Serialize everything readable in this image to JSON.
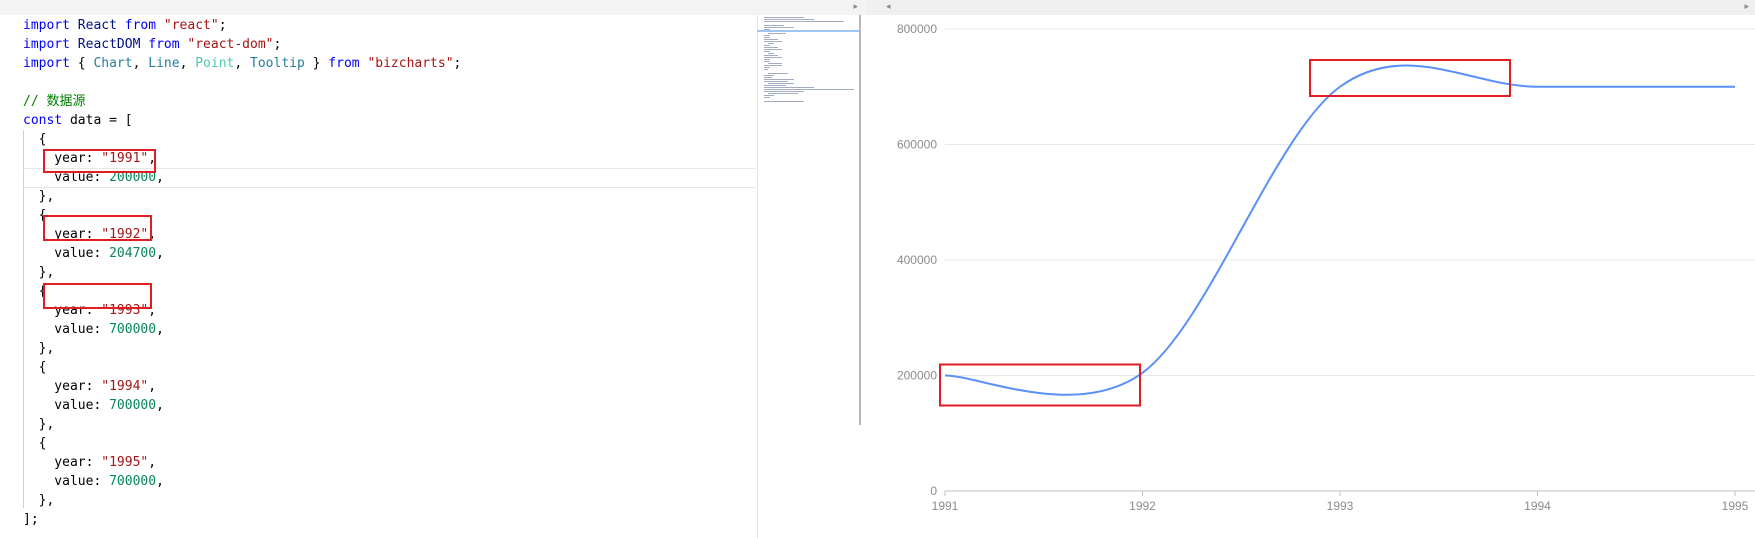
{
  "editor": {
    "lines": [
      [
        [
          "import",
          "kw"
        ],
        [
          " ",
          ""
        ],
        [
          "React",
          "var"
        ],
        [
          " ",
          ""
        ],
        [
          "from",
          "kw"
        ],
        [
          " ",
          ""
        ],
        [
          "\"react\"",
          "str"
        ],
        [
          ";",
          ""
        ]
      ],
      [
        [
          "import",
          "kw"
        ],
        [
          " ",
          ""
        ],
        [
          "ReactDOM",
          "var"
        ],
        [
          " ",
          ""
        ],
        [
          "from",
          "kw"
        ],
        [
          " ",
          ""
        ],
        [
          "\"react-dom\"",
          "str"
        ],
        [
          ";",
          ""
        ]
      ],
      [
        [
          "import",
          "kw"
        ],
        [
          " { ",
          ""
        ],
        [
          "Chart",
          "typ"
        ],
        [
          ", ",
          ""
        ],
        [
          "Line",
          "typ"
        ],
        [
          ", ",
          ""
        ],
        [
          "Point",
          "light"
        ],
        [
          ", ",
          ""
        ],
        [
          "Tooltip",
          "typ"
        ],
        [
          " } ",
          ""
        ],
        [
          "from",
          "kw"
        ],
        [
          " ",
          ""
        ],
        [
          "\"bizcharts\"",
          "str"
        ],
        [
          ";",
          ""
        ]
      ],
      [],
      [
        [
          "// 数据源",
          "cmt"
        ]
      ],
      [
        [
          "const",
          "kw"
        ],
        [
          " data = [",
          ""
        ]
      ],
      [
        [
          "  {",
          ""
        ]
      ],
      [
        [
          "    year: ",
          ""
        ],
        [
          "\"1991\"",
          "str"
        ],
        [
          ",",
          ""
        ]
      ],
      [
        [
          "    value: ",
          ""
        ],
        [
          "200000",
          "num"
        ],
        [
          ",",
          ""
        ]
      ],
      [
        [
          "  },",
          ""
        ]
      ],
      [
        [
          "  {",
          ""
        ]
      ],
      [
        [
          "    year: ",
          ""
        ],
        [
          "\"1992\"",
          "str"
        ],
        [
          ",",
          ""
        ]
      ],
      [
        [
          "    value: ",
          ""
        ],
        [
          "204700",
          "num"
        ],
        [
          ",",
          ""
        ]
      ],
      [
        [
          "  },",
          ""
        ]
      ],
      [
        [
          "  {",
          ""
        ]
      ],
      [
        [
          "    year: ",
          ""
        ],
        [
          "\"1993\"",
          "str"
        ],
        [
          ",",
          ""
        ]
      ],
      [
        [
          "    value: ",
          ""
        ],
        [
          "700000",
          "num"
        ],
        [
          ",",
          ""
        ]
      ],
      [
        [
          "  },",
          ""
        ]
      ],
      [
        [
          "  {",
          ""
        ]
      ],
      [
        [
          "    year: ",
          ""
        ],
        [
          "\"1994\"",
          "str"
        ],
        [
          ",",
          ""
        ]
      ],
      [
        [
          "    value: ",
          ""
        ],
        [
          "700000",
          "num"
        ],
        [
          ",",
          ""
        ]
      ],
      [
        [
          "  },",
          ""
        ]
      ],
      [
        [
          "  {",
          ""
        ]
      ],
      [
        [
          "    year: ",
          ""
        ],
        [
          "\"1995\"",
          "str"
        ],
        [
          ",",
          ""
        ]
      ],
      [
        [
          "    value: ",
          ""
        ],
        [
          "700000",
          "num"
        ],
        [
          ",",
          ""
        ]
      ],
      [
        [
          "  },",
          ""
        ]
      ],
      [
        [
          "];",
          ""
        ]
      ]
    ]
  },
  "chart_data": {
    "type": "line",
    "smooth": true,
    "x": [
      "1991",
      "1992",
      "1993",
      "1994",
      "1995"
    ],
    "y": [
      200000,
      204700,
      700000,
      700000,
      700000
    ],
    "ylim": [
      0,
      800000
    ],
    "yticks": [
      "0",
      "200000",
      "400000",
      "600000",
      "800000"
    ],
    "grid": true,
    "line_color": "#5b8ff9"
  },
  "colors": {
    "highlight": "#e21c24",
    "grid": "#e8e8e8",
    "axis": "#bfbfbf",
    "tick_text": "#8c8c8c"
  }
}
